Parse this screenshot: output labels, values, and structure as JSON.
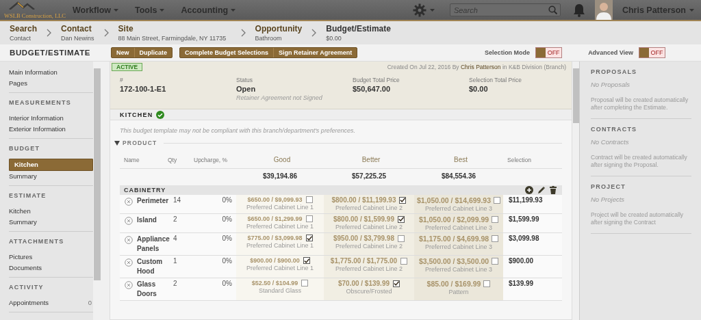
{
  "top_bar": {
    "logo": {
      "name": "WSLB Construction, LLC"
    },
    "menus": [
      {
        "label": "Workflow"
      },
      {
        "label": "Tools"
      },
      {
        "label": "Accounting"
      }
    ],
    "search": {
      "placeholder": "Search"
    },
    "user": {
      "name": "Chris Patterson"
    }
  },
  "breadcrumbs": [
    {
      "title": "Search",
      "subtitle": "Contact"
    },
    {
      "title": "Contact",
      "subtitle": "Dan Newins"
    },
    {
      "title": "Site",
      "subtitle": "88 Main Street, Farmingdale, NY 11735"
    },
    {
      "title": "Opportunity",
      "subtitle": "Bathroom"
    },
    {
      "title": "Budget/Estimate",
      "subtitle": "$0.00"
    }
  ],
  "toolbar": {
    "title": "BUDGET/ESTIMATE",
    "button_groups": [
      [
        "New",
        "Duplicate"
      ],
      [
        "Complete Budget Selections",
        "Sign Retainer Agreement"
      ]
    ],
    "toggles": [
      {
        "label": "Selection Mode",
        "on": false,
        "state_text": "OFF"
      },
      {
        "label": "Advanced View",
        "on": false,
        "state_text": "OFF"
      }
    ]
  },
  "sidebar": {
    "sections": [
      {
        "items": [
          {
            "label": "Main Information",
            "selected": false
          },
          {
            "label": "Pages",
            "selected": false
          }
        ]
      },
      {
        "heading": "MEASUREMENTS",
        "items": [
          {
            "label": "Interior Information",
            "selected": false
          },
          {
            "label": "Exterior Information",
            "selected": false
          }
        ]
      },
      {
        "heading": "BUDGET",
        "items": [
          {
            "label": "Kitchen",
            "selected": true
          },
          {
            "label": "Summary",
            "selected": false
          }
        ]
      },
      {
        "heading": "ESTIMATE",
        "items": [
          {
            "label": "Kitchen",
            "selected": false
          },
          {
            "label": "Summary",
            "selected": false
          }
        ]
      },
      {
        "heading": "ATTACHMENTS",
        "items": [
          {
            "label": "Pictures",
            "selected": false
          },
          {
            "label": "Documents",
            "selected": false
          }
        ]
      },
      {
        "heading": "ACTIVITY",
        "items": [
          {
            "label": "Appointments",
            "selected": false,
            "count": "0"
          }
        ]
      }
    ]
  },
  "main": {
    "status_badge": "ACTIVE",
    "created_line": "Created On Jul 22, 2016 By **Chris Patterson** in K&B Division (Branch)",
    "info": [
      {
        "label": "#",
        "value": "172-100-1-E1"
      },
      {
        "label": "Status",
        "value": "Open",
        "note": "Retainer Agreement not Signed"
      },
      {
        "label": "Budget Total Price",
        "value": "$50,647.00"
      },
      {
        "label": "Selection Total Price",
        "value": "$0.00"
      }
    ],
    "section_title": "KITCHEN",
    "section_complete": true,
    "notice": "This budget template may not be compliant with this branch/department's preferences.",
    "group_title": "PRODUCT",
    "group_expanded": true,
    "table": {
      "columns": [
        "Name",
        "Qty",
        "Upcharge, %",
        "Good",
        "Better",
        "Best",
        "Selection"
      ],
      "totals": [
        "$39,194.86",
        "$57,225.25",
        "$84,554.36"
      ],
      "category": "CABINETRY",
      "rows": [
        {
          "name": "Perimeter",
          "qty": "14",
          "upcharge": "0%",
          "options": [
            {
              "price": "$650.00 / $9,099.93",
              "checked": false,
              "line": "Preferred Cabinet Line 1"
            },
            {
              "price": "$800.00 / $11,199.93",
              "checked": true,
              "line": "Preferred Cabinet Line 2"
            },
            {
              "price": "$1,050.00 / $14,699.93",
              "checked": false,
              "line": "Preferred Cabinet Line 3"
            }
          ],
          "selection": "$11,199.93"
        },
        {
          "name": "Island",
          "qty": "2",
          "upcharge": "0%",
          "options": [
            {
              "price": "$650.00 / $1,299.99",
              "checked": false,
              "line": "Preferred Cabinet Line 1"
            },
            {
              "price": "$800.00 / $1,599.99",
              "checked": true,
              "line": "Preferred Cabinet Line 2"
            },
            {
              "price": "$1,050.00 / $2,099.99",
              "checked": false,
              "line": "Preferred Cabinet Line 3"
            }
          ],
          "selection": "$1,599.99"
        },
        {
          "name": "Appliance Panels",
          "qty": "4",
          "upcharge": "0%",
          "options": [
            {
              "price": "$775.00 / $3,099.98",
              "checked": true,
              "line": "Preferred Cabinet Line 1"
            },
            {
              "price": "$950.00 / $3,799.98",
              "checked": false,
              "line": "Preferred Cabinet Line 2"
            },
            {
              "price": "$1,175.00 / $4,699.98",
              "checked": false,
              "line": "Preferred Cabinet Line 3"
            }
          ],
          "selection": "$3,099.98"
        },
        {
          "name": "Custom Hood",
          "qty": "1",
          "upcharge": "0%",
          "options": [
            {
              "price": "$900.00 / $900.00",
              "checked": true,
              "line": "Preferred Cabinet Line 1"
            },
            {
              "price": "$1,775.00 / $1,775.00",
              "checked": false,
              "line": "Preferred Cabinet Line 2"
            },
            {
              "price": "$3,500.00 / $3,500.00",
              "checked": false,
              "line": "Preferred Cabinet Line 3"
            }
          ],
          "selection": "$900.00"
        },
        {
          "name": "Glass Doors",
          "qty": "2",
          "upcharge": "0%",
          "options": [
            {
              "price": "$52.50 / $104.99",
              "checked": false,
              "line": "Standard Glass"
            },
            {
              "price": "$70.00 / $139.99",
              "checked": true,
              "line": "Obscure/Frosted"
            },
            {
              "price": "$85.00 / $169.99",
              "checked": false,
              "line": "Pattern"
            }
          ],
          "selection": "$139.99"
        }
      ]
    }
  },
  "right_panel": [
    {
      "heading": "PROPOSALS",
      "empty": "No Proposals",
      "note": "Proposal will be created automatically after completing the Estimate."
    },
    {
      "heading": "CONTRACTS",
      "empty": "No Contracts",
      "note": "Contract will be created automatically after signing the Proposal."
    },
    {
      "heading": "PROJECT",
      "empty": "No Projects",
      "note": "Project will be created automatically after signing the Contract"
    }
  ]
}
